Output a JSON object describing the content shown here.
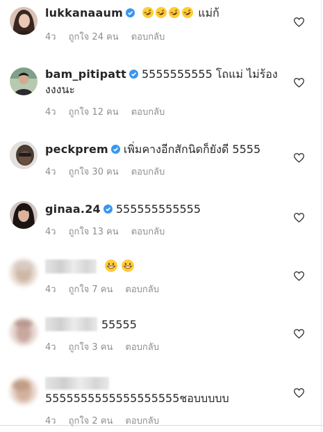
{
  "comments": [
    {
      "username": "lukkanaaum",
      "verified": true,
      "emoji_count": 4,
      "text": "แม่ก้",
      "time": "4ว",
      "likes": "ถูกใจ 24 คน",
      "reply": "ตอบกลับ"
    },
    {
      "username": "bam_pitipatt",
      "verified": true,
      "text": "5555555555 โถแม่ ไม่ร้อง",
      "text_line2": "งงงนะ",
      "time": "4ว",
      "likes": "ถูกใจ 12 คน",
      "reply": "ตอบกลับ"
    },
    {
      "username": "peckprem",
      "verified": true,
      "text": "เพิ่มคางอีกสักนิดก็ยังดี 5555",
      "time": "4ว",
      "likes": "ถูกใจ 30 คน",
      "reply": "ตอบกลับ"
    },
    {
      "username": "ginaa.24",
      "verified": true,
      "text": "555555555555",
      "time": "4ว",
      "likes": "ถูกใจ 13 คน",
      "reply": "ตอบกลับ"
    },
    {
      "username_hidden": true,
      "emoji_count": 2,
      "time": "4ว",
      "likes": "ถูกใจ 7 คน",
      "reply": "ตอบกลับ"
    },
    {
      "username_hidden": true,
      "text": "55555",
      "time": "4ว",
      "likes": "ถูกใจ 3 คน",
      "reply": "ตอบกลับ"
    },
    {
      "username_hidden": true,
      "text": "5555555555555555555ชอบบบบบ",
      "time": "4ว",
      "likes": "ถูกใจ 2 คน",
      "reply": "ตอบกลับ"
    }
  ],
  "colors": {
    "verified_badge": "#3897f0",
    "meta_text": "#8e8e8e",
    "emoji_face": "#ffcc33"
  },
  "icons": {
    "like": "heart-icon",
    "verified": "verified-badge-icon",
    "laughing_emoji": "rolling-on-floor-laughing-emoji",
    "grin_emoji": "grinning-face-emoji"
  }
}
